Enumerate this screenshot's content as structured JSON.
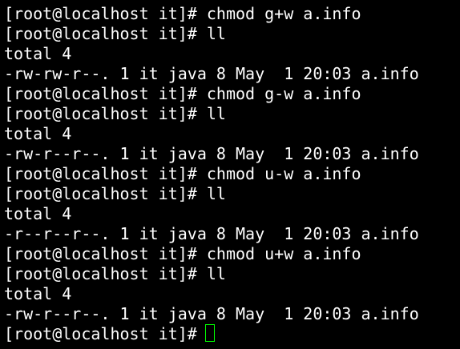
{
  "terminal": {
    "colors": {
      "background": "#000000",
      "text": "#ffffff",
      "cursor": "#00ff00"
    },
    "lines": [
      "[root@localhost it]# chmod g+w a.info",
      "[root@localhost it]# ll",
      "total 4",
      "-rw-rw-r--. 1 it java 8 May  1 20:03 a.info",
      "[root@localhost it]# chmod g-w a.info",
      "[root@localhost it]# ll",
      "total 4",
      "-rw-r--r--. 1 it java 8 May  1 20:03 a.info",
      "[root@localhost it]# chmod u-w a.info",
      "[root@localhost it]# ll",
      "total 4",
      "-r--r--r--. 1 it java 8 May  1 20:03 a.info",
      "[root@localhost it]# chmod u+w a.info",
      "[root@localhost it]# ll",
      "total 4",
      "-rw-r--r--. 1 it java 8 May  1 20:03 a.info"
    ],
    "prompt": "[root@localhost it]#"
  }
}
